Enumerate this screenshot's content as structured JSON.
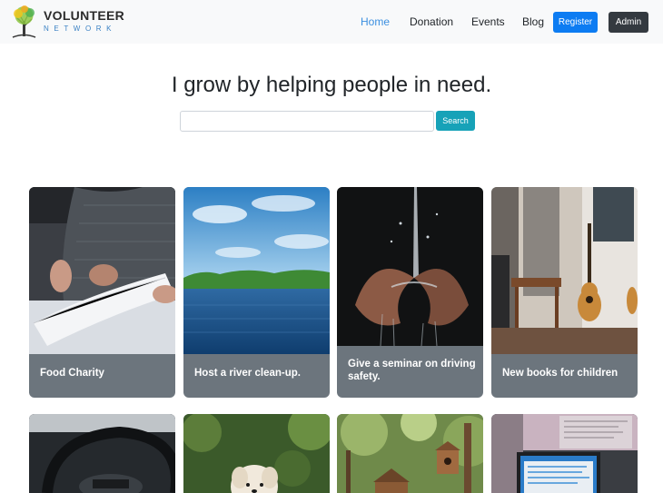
{
  "brand": {
    "title": "VOLUNTEER",
    "subtitle": "NETWORK",
    "logo_icon": "tree-icon"
  },
  "nav": {
    "links": [
      {
        "label": "Home",
        "active": true
      },
      {
        "label": "Donation",
        "active": false
      },
      {
        "label": "Events",
        "active": false
      },
      {
        "label": "Blog",
        "active": false
      }
    ],
    "register_label": "Register",
    "admin_label": "Admin"
  },
  "hero": {
    "title": "I grow by helping people in need.",
    "search_value": "",
    "search_button": "Search"
  },
  "events": [
    {
      "title": "Food Charity",
      "image": "book-reading-photo"
    },
    {
      "title": "Host a river clean-up.",
      "image": "river-lake-photo"
    },
    {
      "title": "Give a seminar on driving safety.",
      "image": "water-hands-photo"
    },
    {
      "title": "New books for children",
      "image": "guitar-room-photo"
    },
    {
      "title": "",
      "image": "car-steering-photo"
    },
    {
      "title": "",
      "image": "puppy-photo"
    },
    {
      "title": "",
      "image": "birdhouse-forest-photo"
    },
    {
      "title": "",
      "image": "computer-monitor-photo"
    }
  ],
  "colors": {
    "primary": "#0d7cf2",
    "info": "#17a2b8",
    "dark": "#343a40",
    "card_caption_bg": "#6c757d",
    "nav_active": "#3b8fe0"
  }
}
